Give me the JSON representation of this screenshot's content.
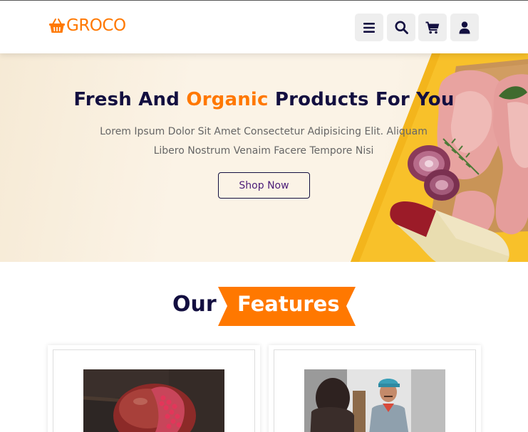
{
  "header": {
    "logo_text": "GROCO",
    "icons": [
      "menu-icon",
      "search-icon",
      "cart-icon",
      "user-icon"
    ]
  },
  "hero": {
    "title_before": "Fresh And ",
    "title_accent": "Organic",
    "title_after": " Products For You",
    "text_line1": "Lorem Ipsum Dolor Sit Amet Consectetur Adipisicing Elit. Aliquam",
    "text_line2": "Libero Nostrum Venaim Facere Tempore Nisi",
    "button_label": "Shop Now"
  },
  "features": {
    "heading_plain": "Our",
    "heading_accent": "Features"
  },
  "colors": {
    "accent": "#ff7800",
    "dark": "#130f40",
    "text_gray": "#666666",
    "hero_yellow": "#f8c12a"
  }
}
